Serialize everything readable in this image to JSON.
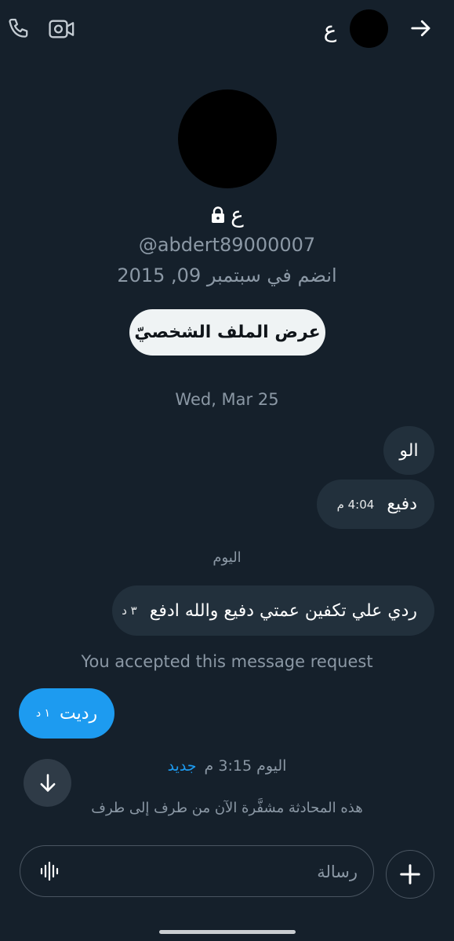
{
  "header": {
    "name": "ع",
    "icons": {
      "call": "phone-icon",
      "video": "video-call-icon",
      "back": "arrow-right-icon"
    }
  },
  "profile": {
    "name": "ع",
    "lock_icon": "lock-icon",
    "handle": "@abdert89000007",
    "joined": "انضم في سبتمبر 09, 2015",
    "view_profile_label": "عرض الملف الشخصيّ"
  },
  "date_separator": "Wed, Mar 25",
  "messages_received": [
    {
      "text": "الو",
      "meta": ""
    },
    {
      "text": "دفيع",
      "meta": "4:04 م"
    }
  ],
  "today_label": "اليوم",
  "message_received_today": {
    "text": "ردي علي تكفين عمتي دفيع والله ادفع",
    "meta": "٣ د"
  },
  "accepted_text": "You accepted this message request",
  "message_sent": {
    "text": "رديت",
    "meta": "١ د"
  },
  "status": {
    "time": "اليوم 3:15 م",
    "new_label": "جديد"
  },
  "encrypted_note": "هذه المحادثة مشفَّرة الآن من طرف إلى طرف",
  "composer": {
    "placeholder": "رسالة",
    "voice_icon": "voice-wave-icon",
    "add_icon": "plus-icon"
  },
  "colors": {
    "background": "#15202b",
    "bubble_received": "#22303c",
    "bubble_sent": "#1d9bf0",
    "muted_text": "#8b98a5",
    "accent": "#1d9bf0"
  }
}
